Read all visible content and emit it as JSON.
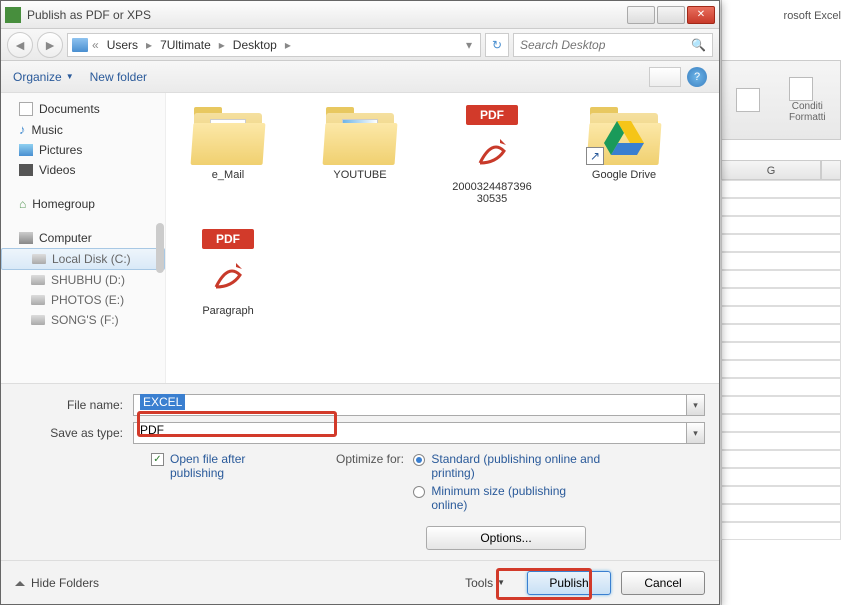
{
  "excel": {
    "app": "rosoft Excel",
    "ribbon1": "Conditi",
    "ribbon2": "Formatti",
    "col": "G"
  },
  "titlebar": {
    "title": "Publish as PDF or XPS"
  },
  "nav": {
    "crumbs": [
      "Users",
      "7Ultimate",
      "Desktop"
    ],
    "search_placeholder": "Search Desktop"
  },
  "toolbar": {
    "organize": "Organize",
    "newfolder": "New folder"
  },
  "sidebar": {
    "documents": "Documents",
    "music": "Music",
    "pictures": "Pictures",
    "videos": "Videos",
    "homegroup": "Homegroup",
    "computer": "Computer",
    "drives": [
      "Local Disk (C:)",
      "SHUBHU (D:)",
      "PHOTOS (E:)",
      "SONG'S (F:)"
    ]
  },
  "files": {
    "email": "e_Mail",
    "youtube": "YOUTUBE",
    "pdfnum": "2000324487396\n30535",
    "gdrive": "Google Drive",
    "paragraph": "Paragraph"
  },
  "fields": {
    "filename_label": "File name:",
    "filename_value": "EXCEL",
    "savetype_label": "Save as type:",
    "savetype_value": "PDF"
  },
  "options": {
    "openafter": "Open file after publishing",
    "optimize_label": "Optimize for:",
    "standard": "Standard (publishing online and printing)",
    "minimum": "Minimum size (publishing online)",
    "options_btn": "Options..."
  },
  "footer": {
    "hide": "Hide Folders",
    "tools": "Tools",
    "publish": "Publish",
    "cancel": "Cancel"
  }
}
